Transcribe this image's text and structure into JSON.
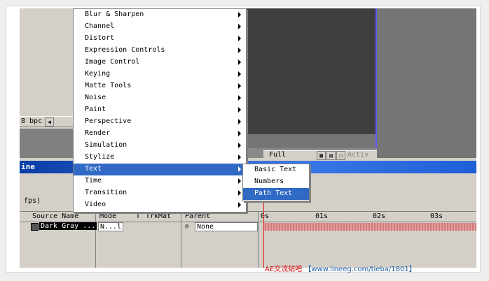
{
  "menu": {
    "items": [
      {
        "label": "Blur & Sharpen"
      },
      {
        "label": "Channel"
      },
      {
        "label": "Distort"
      },
      {
        "label": "Expression Controls"
      },
      {
        "label": "Image Control"
      },
      {
        "label": "Keying"
      },
      {
        "label": "Matte Tools"
      },
      {
        "label": "Noise"
      },
      {
        "label": "Paint"
      },
      {
        "label": "Perspective"
      },
      {
        "label": "Render"
      },
      {
        "label": "Simulation"
      },
      {
        "label": "Stylize"
      },
      {
        "label": "Text"
      },
      {
        "label": "Time"
      },
      {
        "label": "Transition"
      },
      {
        "label": "Video"
      }
    ],
    "selected_index": 13
  },
  "submenu": {
    "items": [
      {
        "label": "Basic Text"
      },
      {
        "label": "Numbers"
      },
      {
        "label": "Path Text"
      }
    ],
    "selected_index": 2
  },
  "project": {
    "bpc_label": "8 bpc"
  },
  "viewer": {
    "zoom_label": "Full",
    "view_label": "Activ"
  },
  "timeline": {
    "title": "ine",
    "fps_label": "fps)",
    "columns": {
      "source_name": "Source Name",
      "mode": "Mode",
      "t": "T",
      "trkmat": "TrkMat",
      "parent": "Parent"
    },
    "ruler": [
      "0s",
      "01s",
      "02s",
      "03s"
    ],
    "layer": {
      "name": "Dark Gray ...",
      "mode": "N...l",
      "parent": "None"
    }
  },
  "watermark": {
    "brand": "AE交流贴吧",
    "url": "【www.lineeg.com/tieba/1801】"
  },
  "colors": {
    "selection": "#316ac5",
    "title_bar": "#1f5fd6",
    "layer_bar": "#d98a8a"
  }
}
